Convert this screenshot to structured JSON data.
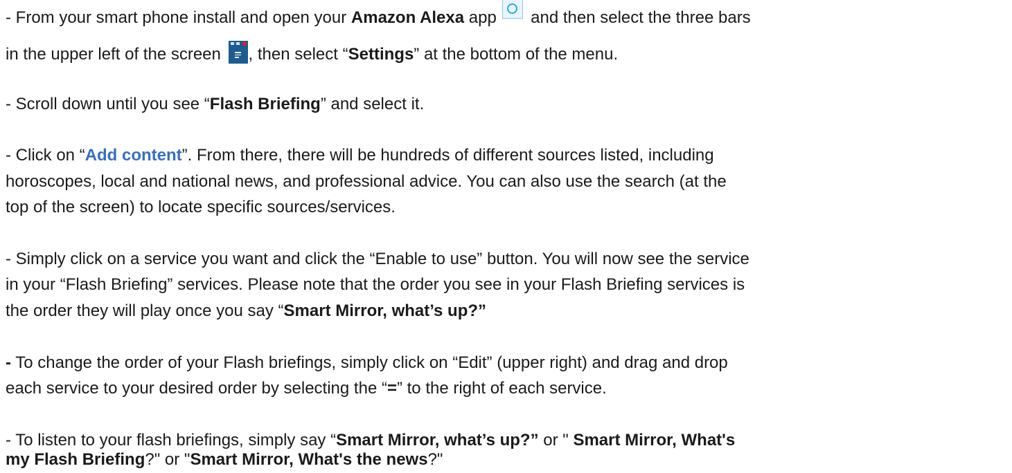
{
  "instructions": {
    "step1": {
      "prefix": "- From your smart phone install and open your ",
      "app_name": "Amazon Alexa",
      "after_app": " app ",
      "after_icon": " and then select the three bars",
      "line2_prefix": "in the upper left of the screen ",
      "line2_middle": ", then select “",
      "settings": "Settings",
      "line2_suffix": "” at the bottom of the menu."
    },
    "step2": {
      "prefix": "- Scroll down until you see “",
      "flash_briefing": "Flash Briefing",
      "suffix": "” and select it."
    },
    "step3": {
      "prefix": "- Click on “",
      "add_content": "Add content",
      "line1_suffix": "”. From there, there will be hundreds of different sources listed, including",
      "line2": "horoscopes, local and national news, and professional advice. You can also use the search (at the",
      "line3": "top of the screen) to locate specific sources/services."
    },
    "step4": {
      "line1": "- Simply click on a service you want and click the “Enable to use” button. You will now see the service",
      "line2": "in your “Flash Briefing” services. Please note that the order you see in your Flash Briefing services is",
      "line3_prefix": "the order they will play once you say “",
      "phrase": "Smart Mirror, what’s up?”"
    },
    "step5": {
      "dash": "-",
      "line1_rest": " To change the order of your Flash briefings, simply click on “Edit” (upper right) and drag and drop",
      "line2_prefix": "each service to your desired order by selecting the “",
      "symbol": "=",
      "line2_suffix": "” to the right of each service."
    },
    "step6": {
      "prefix": "- To listen to your flash briefings, simply say “",
      "phrase1": "Smart Mirror, what’s up?”",
      "or1": " or \" ",
      "phrase2_line1": "Smart Mirror, What's",
      "phrase2_line2": "my Flash Briefing",
      "mid": "?\" or \"",
      "phrase3": "Smart Mirror, What's the news",
      "end": "?\""
    }
  },
  "icons": {
    "alexa": "alexa-app-icon",
    "menu": "three-bars-menu-icon"
  },
  "colors": {
    "link": "#3b6fb6",
    "menu_icon_bg": "#1e5b8e",
    "alexa_ring": "#2aa9e0"
  }
}
